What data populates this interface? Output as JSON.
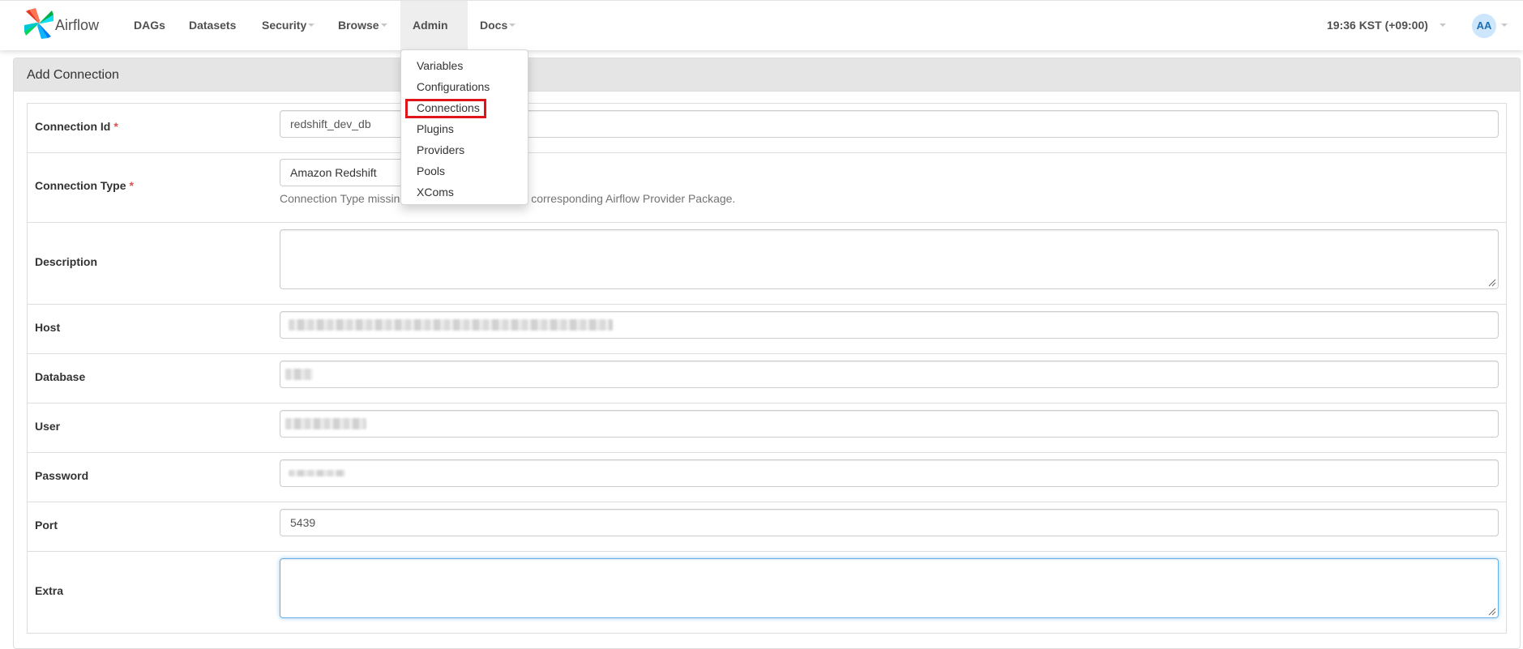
{
  "navbar": {
    "brand": "Airflow",
    "items": [
      {
        "label": "DAGs",
        "has_caret": false
      },
      {
        "label": "Datasets",
        "has_caret": false
      },
      {
        "label": "Security",
        "has_caret": true
      },
      {
        "label": "Browse",
        "has_caret": true
      },
      {
        "label": "Admin",
        "has_caret": true,
        "active": true
      },
      {
        "label": "Docs",
        "has_caret": true
      }
    ],
    "clock": "19:36 KST (+09:00)",
    "avatar_initials": "AA"
  },
  "admin_menu": {
    "items": [
      "Variables",
      "Configurations",
      "Connections",
      "Plugins",
      "Providers",
      "Pools",
      "XComs"
    ],
    "highlighted": "Connections",
    "highlight_color": "#e0151c"
  },
  "panel": {
    "title": "Add Connection"
  },
  "form": {
    "connection_id": {
      "label": "Connection Id",
      "required": "*",
      "value": "redshift_dev_db"
    },
    "connection_type": {
      "label": "Connection Type",
      "required": "*",
      "value": "Amazon Redshift",
      "help_left": "Connection Type missin",
      "help_right": "alled the corresponding Airflow Provider Package."
    },
    "description": {
      "label": "Description",
      "value": ""
    },
    "host": {
      "label": "Host",
      "value_redacted": true
    },
    "database": {
      "label": "Database",
      "value_redacted": true
    },
    "user": {
      "label": "User",
      "value_redacted": true
    },
    "password": {
      "label": "Password",
      "value_redacted": true
    },
    "port": {
      "label": "Port",
      "value": "5439"
    },
    "extra": {
      "label": "Extra",
      "value": ""
    }
  },
  "colors": {
    "required_star": "#d9534f",
    "focus_border": "#66afe9",
    "panel_header_bg": "#e5e5e5",
    "nav_active_bg": "#eeeeee"
  }
}
